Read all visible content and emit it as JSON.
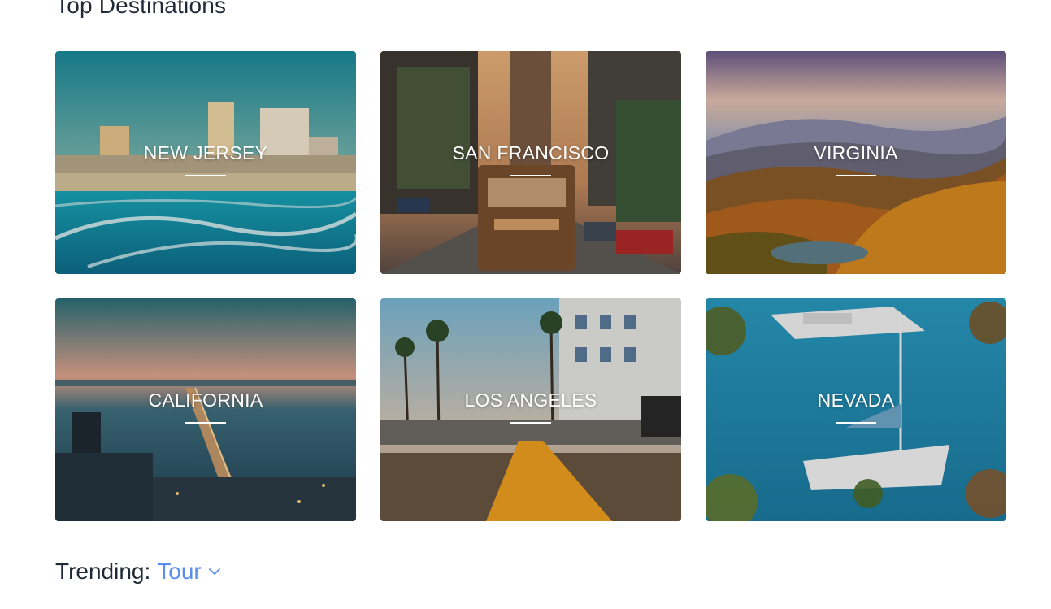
{
  "section": {
    "title": "Top Destinations"
  },
  "destinations": [
    {
      "name": "NEW JERSEY",
      "scene": "beach-skyline"
    },
    {
      "name": "SAN FRANCISCO",
      "scene": "city-street-cable-car"
    },
    {
      "name": "VIRGINIA",
      "scene": "autumn-mountains"
    },
    {
      "name": "CALIFORNIA",
      "scene": "bay-bridge-night"
    },
    {
      "name": "LOS ANGELES",
      "scene": "palm-street"
    },
    {
      "name": "NEVADA",
      "scene": "lake-boats"
    }
  ],
  "trending": {
    "label": "Trending:",
    "selected": "Tour",
    "icon": "chevron-down-icon",
    "accent_color": "#5b8def"
  }
}
